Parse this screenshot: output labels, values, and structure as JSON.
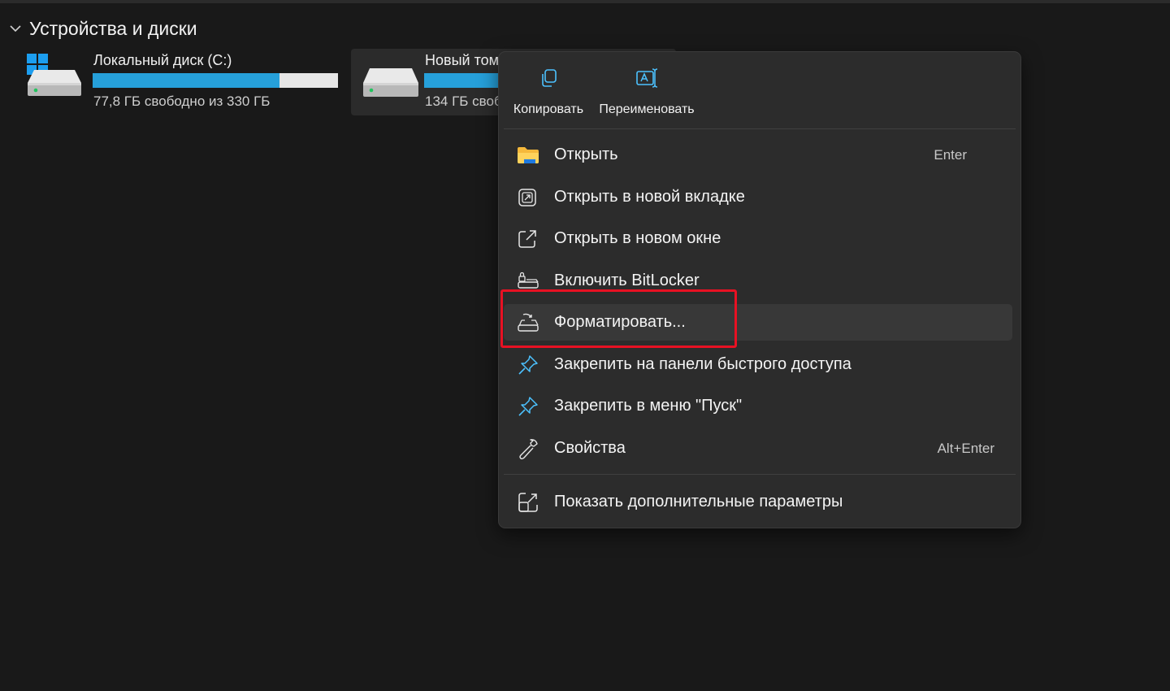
{
  "section": {
    "title": "Устройства и диски",
    "chevron_icon": "chevron-down-icon"
  },
  "drives": [
    {
      "name": "Локальный диск (C:)",
      "free_text": "77,8 ГБ свободно из 330 ГБ",
      "used_fraction": 0.76,
      "icon": "windows-drive-icon"
    },
    {
      "name": "Новый том",
      "free_text": "134 ГБ своб",
      "used_fraction": 0.5,
      "icon": "drive-icon"
    }
  ],
  "context_menu": {
    "quick_actions": [
      {
        "label": "Копировать",
        "icon": "copy-icon"
      },
      {
        "label": "Переименовать",
        "icon": "rename-icon"
      }
    ],
    "items": [
      {
        "label": "Открыть",
        "shortcut": "Enter",
        "icon": "folder-icon"
      },
      {
        "label": "Открыть в новой вкладке",
        "shortcut": "",
        "icon": "new-tab-icon"
      },
      {
        "label": "Открыть в новом окне",
        "shortcut": "",
        "icon": "new-window-icon"
      },
      {
        "label": "Включить BitLocker",
        "shortcut": "",
        "icon": "bitlocker-icon"
      },
      {
        "label": "Форматировать...",
        "shortcut": "",
        "icon": "format-icon",
        "selected": true
      },
      {
        "label": "Закрепить на панели быстрого доступа",
        "shortcut": "",
        "icon": "pin-icon"
      },
      {
        "label": "Закрепить в меню \"Пуск\"",
        "shortcut": "",
        "icon": "pin-icon"
      },
      {
        "label": "Свойства",
        "shortcut": "Alt+Enter",
        "icon": "wrench-icon"
      }
    ],
    "more_options": {
      "label": "Показать дополнительные параметры",
      "icon": "more-options-icon"
    }
  },
  "colors": {
    "background": "#191919",
    "menu_background": "#2c2c2c",
    "usage_bar": "#26a0da",
    "highlight_box": "#e81123",
    "accent_icon": "#4cc2ff"
  }
}
